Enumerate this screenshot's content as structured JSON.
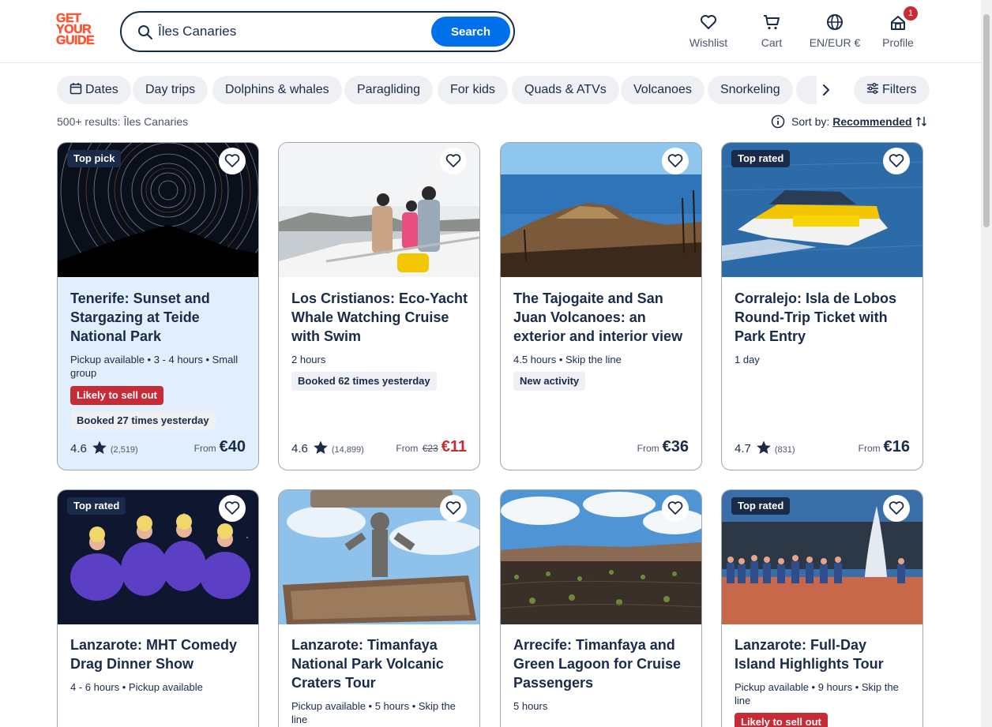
{
  "brand": {
    "logo_lines": [
      "GET",
      "YOUR",
      "GUIDE"
    ],
    "color": "#ff5533"
  },
  "search": {
    "value": "Îles Canaries",
    "button_label": "Search"
  },
  "nav": {
    "wishlist": "Wishlist",
    "cart": "Cart",
    "language": "EN/EUR €",
    "profile": "Profile",
    "profile_badge": "1"
  },
  "chips": [
    {
      "label": "Dates",
      "icon": "calendar-icon"
    },
    {
      "label": "Day trips"
    },
    {
      "label": "Dolphins & whales"
    },
    {
      "label": "Paragliding"
    },
    {
      "label": "For kids"
    },
    {
      "label": "Quads & ATVs"
    },
    {
      "label": "Volcanoes"
    },
    {
      "label": "Snorkeling"
    }
  ],
  "filters_label": "Filters",
  "results": {
    "text": "500+ results: Îles Canaries"
  },
  "sort": {
    "label": "Sort by:",
    "value": "Recommended"
  },
  "colors": {
    "accent": "#0071eb",
    "text": "#1a2b49",
    "sale": "#c62b36"
  },
  "cards": [
    {
      "tag": "Top pick",
      "title": "Tenerife: Sunset and Stargazing at Teide National Park",
      "meta": "Pickup available • 3 - 4 hours • Small group",
      "pill_red": "Likely to sell out",
      "pill_grey": "Booked 27 times yesterday",
      "rating": "4.6",
      "reviews": "(2,519)",
      "from": "From",
      "price": "€40",
      "image": "star-trails-photo"
    },
    {
      "tag": "",
      "title": "Los Cristianos: Eco-Yacht Whale Watching Cruise with Swim",
      "meta": "2 hours",
      "pill_grey": "Booked 62 times yesterday",
      "rating": "4.6",
      "reviews": "(14,899)",
      "from": "From",
      "old_price": "€23",
      "price": "€11",
      "image": "family-on-boat-photo"
    },
    {
      "tag": "",
      "title": "The Tajogaite and San Juan Volcanoes: an exterior and interior view",
      "meta": "4.5 hours • Skip the line",
      "pill_grey": "New activity",
      "from": "From",
      "price": "€36",
      "image": "volcano-photo"
    },
    {
      "tag": "Top rated",
      "title": "Corralejo: Isla de Lobos Round-Trip Ticket with Park Entry",
      "meta": "1 day",
      "rating": "4.7",
      "reviews": "(831)",
      "from": "From",
      "price": "€16",
      "image": "water-taxi-photo"
    },
    {
      "tag": "Top rated",
      "title": "Lanzarote: MHT Comedy Drag Dinner Show",
      "meta": "4 - 6 hours • Pickup available",
      "image": "drag-show-photo"
    },
    {
      "tag": "",
      "title": "Lanzarote: Timanfaya National Park Volcanic Craters Tour",
      "meta": "Pickup available • 5 hours • Skip the line",
      "image": "timanfaya-sign-photo"
    },
    {
      "tag": "",
      "title": "Arrecife: Timanfaya and Green Lagoon for Cruise Passengers",
      "meta": "5 hours",
      "image": "vineyard-landscape-photo"
    },
    {
      "tag": "Top rated",
      "title": "Lanzarote: Full-Day Island Highlights Tour",
      "meta": "Pickup available • 9 hours • Skip the line",
      "pill_red": "Likely to sell out",
      "image": "geyser-crowd-photo"
    }
  ]
}
